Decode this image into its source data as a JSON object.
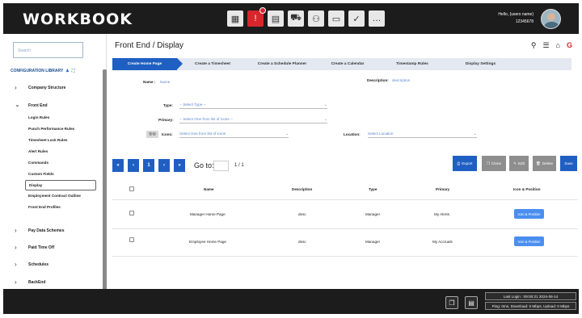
{
  "app": {
    "logo": "WORKBOOK"
  },
  "header": {
    "icons": [
      "grid-icon",
      "alert-icon",
      "calendar-icon",
      "truck-icon",
      "team-icon",
      "monitor-icon",
      "calendar-check-icon",
      "chat-icon"
    ],
    "user_greeting": "Hello, {users name}",
    "user_id": "12345678"
  },
  "sidebar": {
    "search_placeholder": "Search",
    "section_title": "CONFIGURATION LIBRARY",
    "items": [
      {
        "label": "Company Structure",
        "expanded": false
      },
      {
        "label": "Front End",
        "expanded": true
      },
      {
        "label": "Pay Data Schemes",
        "expanded": false
      },
      {
        "label": "Paid Time Off",
        "expanded": false
      },
      {
        "label": "Schedules",
        "expanded": false
      },
      {
        "label": "BackEnd",
        "expanded": false
      }
    ],
    "subitems": [
      "Login Rules",
      "Punch Performance Rules",
      "Timesheet Lock Rules",
      "Alert Rules",
      "Commands",
      "Custom Fields",
      "Display",
      "Employment Contract Outline",
      "Front End Profiles"
    ],
    "active_subitem": "Display"
  },
  "main": {
    "title": "Front End / Display",
    "steps": [
      "Create Home Page",
      "Create a Timesheet",
      "Create a Schedule Planner",
      "Create a Calendar",
      "Timestamp Rules",
      "Display Settings"
    ],
    "active_step": 0,
    "form": {
      "name_label": "Name :",
      "name_value": "Name",
      "description_label": "Description:",
      "description_value": "description",
      "type_label": "Type:",
      "type_value": "-- Select Type --",
      "primary_label": "Primary:",
      "primary_value": "-- Select One from list of icons --",
      "icons_label": "Icons:",
      "icons_value": "Select One from list of icons",
      "location_label": "Location:",
      "location_value": "Select Location"
    },
    "pager": {
      "first": "«",
      "prev": "‹",
      "page": "1",
      "next": "›",
      "last": "»",
      "goto_label": "Go to:",
      "page_info": "1 / 1"
    },
    "actions": {
      "export": "Export",
      "clone": "Clone",
      "edit": "Edit",
      "delete": "Delete",
      "save": "Save"
    },
    "table": {
      "columns": [
        "Name",
        "Description",
        "Type",
        "Primary",
        "Icon & Position"
      ],
      "rows": [
        {
          "name": "Manager Home Page",
          "description": "desc",
          "type": "Manager",
          "primary": "My Alerts",
          "button": "Icon & Position"
        },
        {
          "name": "Employee Home Page",
          "description": "desc",
          "type": "Manager",
          "primary": "My Accruals",
          "button": "Icon & Position"
        }
      ]
    }
  },
  "footer": {
    "last_login": "Last Login : 09:00:21 2024-06-14",
    "network": "Ping: 0ms, Download: 0 Mbps, Upload: 0 Mbps"
  }
}
